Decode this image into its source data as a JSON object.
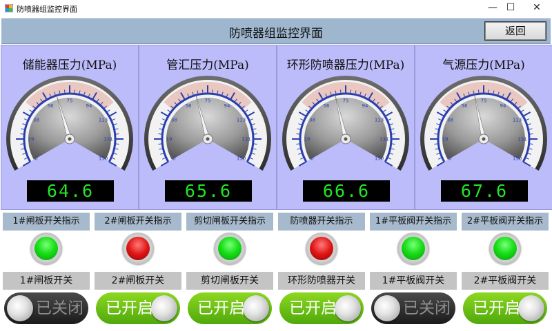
{
  "window": {
    "title": "防喷器组监控界面",
    "minimize_glyph": "—",
    "maximize_glyph": "☐",
    "close_glyph": "✕"
  },
  "header": {
    "title": "防喷器组监控界面",
    "back_label": "返回"
  },
  "gauge_scale": {
    "min": 0,
    "max": 150,
    "tick_labels": [
      "0",
      "19",
      "38",
      "56",
      "75",
      "94",
      "113",
      "131",
      "150"
    ]
  },
  "gauges": [
    {
      "label": "储能器压力(MPa)",
      "value": 64.6,
      "display": "64.6"
    },
    {
      "label": "管汇压力(MPa)",
      "value": 65.6,
      "display": "65.6"
    },
    {
      "label": "环形防喷器压力(MPa)",
      "value": 66.6,
      "display": "66.6"
    },
    {
      "label": "气源压力(MPa)",
      "value": 67.6,
      "display": "67.6"
    }
  ],
  "indicators": [
    {
      "label": "1#闸板开关指示",
      "state": "green"
    },
    {
      "label": "2#闸板开关指示",
      "state": "red"
    },
    {
      "label": "剪切闸板开关指示",
      "state": "green"
    },
    {
      "label": "防喷器开关指示",
      "state": "red"
    },
    {
      "label": "1#平板阀开关指示",
      "state": "green"
    },
    {
      "label": "2#平板阀开关指示",
      "state": "green"
    }
  ],
  "switches": [
    {
      "label": "1#闸板开关",
      "state": "off",
      "text": "已关闭"
    },
    {
      "label": "2#闸板开关",
      "state": "on",
      "text": "已开启"
    },
    {
      "label": "剪切闸板开关",
      "state": "on",
      "text": "已开启"
    },
    {
      "label": "环形防喷器开关",
      "state": "on",
      "text": "已开启"
    },
    {
      "label": "1#平板阀开关",
      "state": "off",
      "text": "已关闭"
    },
    {
      "label": "2#平板阀开关",
      "state": "on",
      "text": "已开启"
    }
  ],
  "colors": {
    "header_bg": "#9fb6cf",
    "gauge_panel_bg": "#bcbcfa",
    "lcd_text": "#22e626",
    "lamp_green": "#19e019",
    "lamp_red": "#e01515",
    "toggle_on": "#6cc416",
    "toggle_off": "#2a2a2a",
    "gauge_scale_blue": "#2a3fb0"
  }
}
